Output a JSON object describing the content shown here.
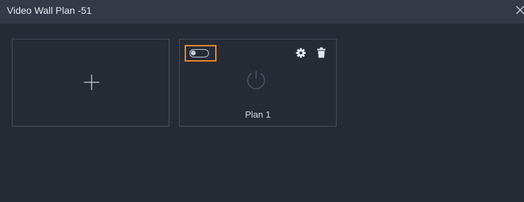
{
  "window": {
    "title": "Video Wall Plan -51",
    "close_icon": "close-icon"
  },
  "add_card": {
    "icon": "plus-icon"
  },
  "plans": [
    {
      "name": "Plan 1",
      "enabled": false,
      "toggle_icon": "toggle-switch-icon",
      "status_icon": "power-icon",
      "actions": [
        "gear-icon",
        "trash-icon"
      ]
    }
  ],
  "colors": {
    "background": "#262b36",
    "titlebar": "#343a48",
    "card_border": "#4a5060",
    "highlight": "#f08b2a",
    "text": "#e6e9ef"
  }
}
